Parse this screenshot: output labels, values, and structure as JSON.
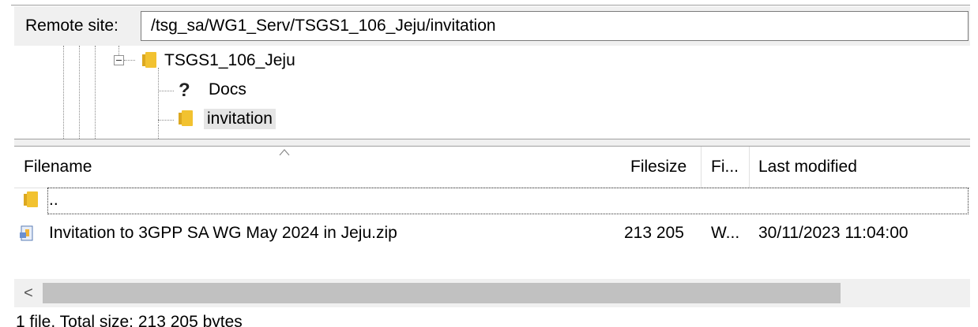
{
  "remote_site": {
    "label": "Remote site:",
    "path": "/tsg_sa/WG1_Serv/TSGS1_106_Jeju/invitation"
  },
  "tree": {
    "parent": "TSGS1_106_Jeju",
    "children": [
      {
        "label": "Docs",
        "icon": "unknown-folder-icon"
      },
      {
        "label": "invitation",
        "icon": "folder-icon",
        "selected": true
      }
    ]
  },
  "file_list": {
    "columns": [
      "Filename",
      "Filesize",
      "Fi...",
      "Last modified"
    ],
    "sort_column": "Filename",
    "parent_entry": "..",
    "rows": [
      {
        "name": "Invitation to 3GPP SA WG May 2024 in Jeju.zip",
        "size": "213 205",
        "type": "W...",
        "modified": "30/11/2023 11:04:00"
      }
    ]
  },
  "scroll_left_glyph": "<",
  "status": "1 file. Total size: 213 205 bytes"
}
